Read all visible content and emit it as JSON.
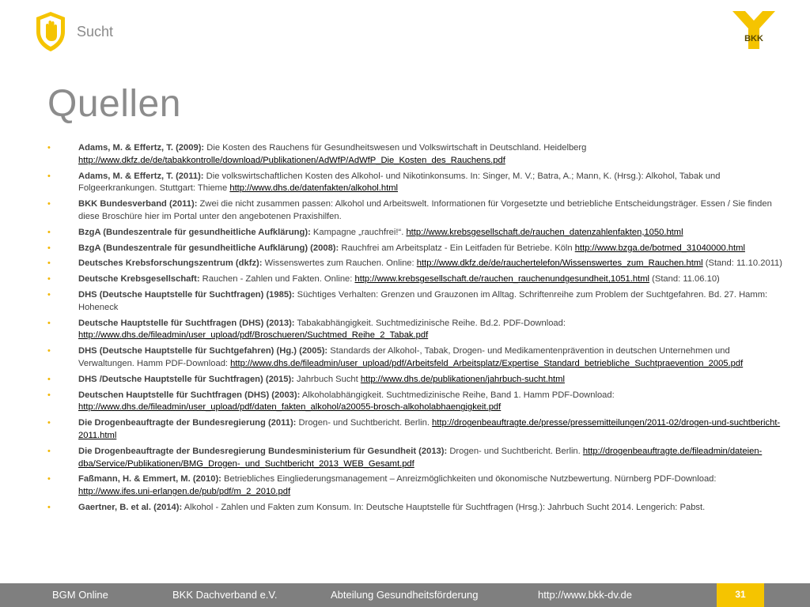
{
  "header": {
    "topic": "Sucht",
    "logo_text": "BKK",
    "shield_icon": "hand-stop-icon",
    "accent_color": "#f5c400"
  },
  "main": {
    "title": "Quellen",
    "references": [
      {
        "author": "Adams, M. & Effertz, T. (2009):",
        "text": " Die Kosten des Rauchens für Gesundheitswesen und Volkswirtschaft in Deutschland. Heidelberg ",
        "link": "http://www.dkfz.de/de/tabakkontrolle/download/Publikationen/AdWfP/AdWfP_Die_Kosten_des_Rauchens.pdf",
        "extra": ""
      },
      {
        "author": "Adams, M. & Effertz, T. (2011):",
        "text": " Die volkswirtschaftlichen Kosten des Alkohol- und Nikotinkonsums. In: Singer, M. V.;  Batra, A.; Mann, K. (Hrsg.): Alkohol, Tabak und Folgeerkrankungen. Stuttgart: Thieme  ",
        "link": "http://www.dhs.de/datenfakten/alkohol.html",
        "extra": ""
      },
      {
        "author": "BKK Bundesverband (2011):",
        "text": " Zwei die nicht zusammen passen: Alkohol und Arbeitswelt. Informationen für Vorgesetzte und betriebliche Entscheidungsträger. Essen / Sie finden diese Broschüre hier im Portal unter den angebotenen Praxishilfen.",
        "link": "",
        "extra": ""
      },
      {
        "author": "BzgA (Bundeszentrale für gesundheitliche Aufklärung):",
        "text": " Kampagne „rauchfrei!“. ",
        "link": "http://www.krebsgesellschaft.de/rauchen_datenzahlenfakten,1050.html",
        "extra": ""
      },
      {
        "author": "BzgA (Bundeszentrale für gesundheitliche Aufklärung) (2008):",
        "text": " Rauchfrei am Arbeitsplatz - Ein Leitfaden für Betriebe. Köln ",
        "link": "http://www.bzga.de/botmed_31040000.html",
        "extra": ""
      },
      {
        "author": "Deutsches Krebsforschungszentrum (dkfz):",
        "text": " Wissenswertes zum Rauchen. Online: ",
        "link": "http://www.dkfz.de/de/rauchertelefon/Wissenswertes_zum_Rauchen.html",
        "extra": "  (Stand: 11.10.2011)"
      },
      {
        "author": "Deutsche Krebsgesellschaft:",
        "text": " Rauchen - Zahlen und Fakten. Online: ",
        "link": "http://www.krebsgesellschaft.de/rauchen_rauchenundgesundheit,1051.html",
        "extra": " (Stand: 11.06.10)"
      },
      {
        "author": "DHS (Deutsche Hauptstelle für Suchtfragen) (1985):",
        "text": " Süchtiges Verhalten: Grenzen und Grauzonen im Alltag. Schriftenreihe zum Problem der Suchtgefahren. Bd. 27. Hamm: Hoheneck",
        "link": "",
        "extra": ""
      },
      {
        "author": "Deutsche Hauptstelle für Suchtfragen (DHS) (2013):",
        "text": " Tabakabhängigkeit. Suchtmedizinische Reihe. Bd.2.   PDF-Download: ",
        "link": "http://www.dhs.de/fileadmin/user_upload/pdf/Broschueren/Suchtmed_Reihe_2_Tabak.pdf",
        "extra": ""
      },
      {
        "author": "DHS (Deutsche Hauptstelle für Suchtgefahren) (Hg.) (2005):",
        "text": " Standards der Alkohol-, Tabak, Drogen- und Medikamentenprävention in deutschen Unternehmen und Verwaltungen. Hamm PDF-Download: ",
        "link": "http://www.dhs.de/fileadmin/user_upload/pdf/Arbeitsfeld_Arbeitsplatz/Expertise_Standard_betriebliche_Suchtpraevention_2005.pdf",
        "extra": ""
      },
      {
        "author": "DHS /Deutsche Hauptstelle für Suchtfragen) (2015):",
        "text": " Jahrbuch Sucht ",
        "link": "http://www.dhs.de/publikationen/jahrbuch-sucht.html",
        "extra": ""
      },
      {
        "author": "Deutschen Hauptstelle für Suchtfragen (DHS) (2003):",
        "text": " Alkoholabhängigkeit. Suchtmedizinische Reihe, Band 1. Hamm PDF-Download: ",
        "link": "http://www.dhs.de/fileadmin/user_upload/pdf/daten_fakten_alkohol/a20055-brosch-alkoholabhaengigkeit.pdf",
        "extra": ""
      },
      {
        "author": "Die Drogenbeauftragte der Bundesregierung (2011):",
        "text": " Drogen- und Suchtbericht. Berlin. ",
        "link": "http://drogenbeauftragte.de/presse/pressemitteilungen/2011-02/drogen-und-suchtbericht-2011.html",
        "extra": ""
      },
      {
        "author": "Die Drogenbeauftragte der Bundesregierung Bundesministerium für Gesundheit (2013):",
        "text": " Drogen- und Suchtbericht. Berlin. ",
        "link": "http://drogenbeauftragte.de/fileadmin/dateien-dba/Service/Publikationen/BMG_Drogen-_und_Suchtbericht_2013_WEB_Gesamt.pdf",
        "extra": ""
      },
      {
        "author": "Faßmann, H. & Emmert, M. (2010):",
        "text": " Betriebliches Eingliederungsmanagement – Anreizmöglichkeiten und ökonomische Nutzbewertung. Nürnberg PDF-Download: ",
        "link": "http://www.ifes.uni-erlangen.de/pub/pdf/m_2_2010.pdf",
        "extra": ""
      },
      {
        "author": "Gaertner, B. et al. (2014):",
        "text": " Alkohol - Zahlen und Fakten zum Konsum. In: Deutsche Hauptstelle für Suchtfragen (Hrsg.): Jahrbuch Sucht 2014. Lengerich: Pabst.",
        "link": "",
        "extra": ""
      }
    ]
  },
  "footer": {
    "item1": "BGM Online",
    "item2": "BKK Dachverband e.V.",
    "item3": "Abteilung Gesundheitsförderung",
    "item4": "http://www.bkk-dv.de",
    "page_number": "31"
  }
}
